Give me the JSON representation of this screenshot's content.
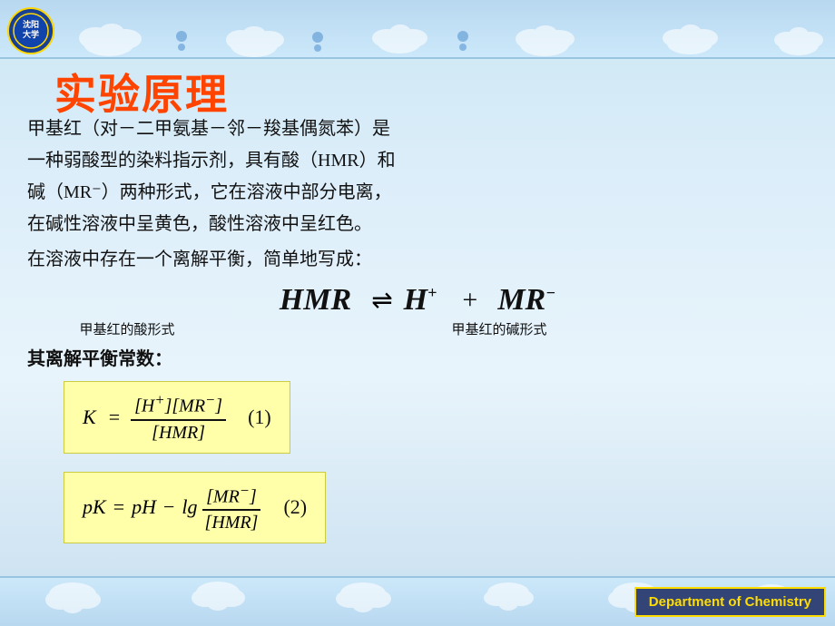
{
  "slide": {
    "title": "实验原理",
    "logo_text": "沈大",
    "para1_line1": "甲基红（对－二甲氨基－邻－羧基偶氮苯）是",
    "para1_line2": "一种弱酸型的染料指示剂，具有酸（HMR）和",
    "para1_line3": "碱（MR⁻）两种形式，它在溶液中部分电离，",
    "para1_line4": "在碱性溶液中呈黄色，酸性溶液中呈红色。",
    "para2": "在溶液中存在一个离解平衡，简单地写成：",
    "eq_left": "HMR",
    "eq_arrow": "⇌",
    "eq_h": "H",
    "eq_h_sup": "+",
    "eq_plus": "+",
    "eq_mr": "MR",
    "eq_mr_sup": "−",
    "label_acid": "甲基红的酸形式",
    "label_base": "甲基红的碱形式",
    "para3": "其离解平衡常数：",
    "formula1": {
      "lhs": "K",
      "eq": "=",
      "num": "[H⁺][MR⁻]",
      "den": "[HMR]",
      "number": "(1)"
    },
    "formula2": {
      "lhs": "pK",
      "eq": "=",
      "ph": "pH",
      "minus": "−",
      "lg": "lg",
      "num": "[MR⁻]",
      "den": "[HMR]",
      "number": "(2)"
    },
    "dept": "Department of Chemistry"
  }
}
